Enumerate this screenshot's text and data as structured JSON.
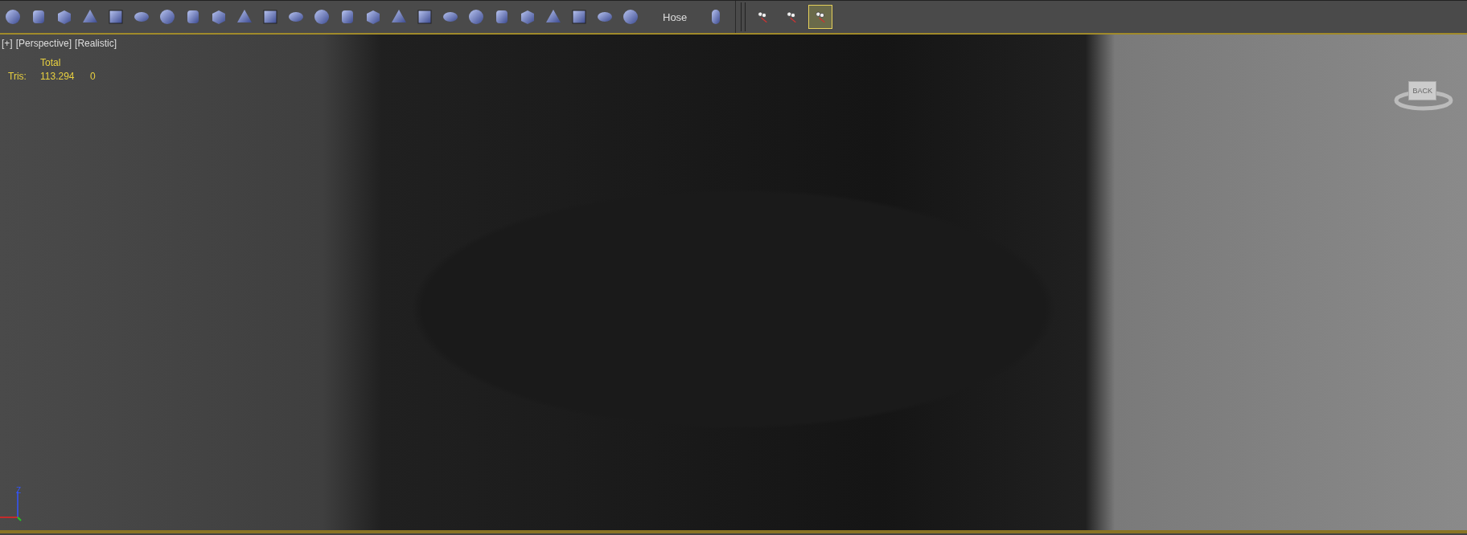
{
  "toolbar": {
    "hose_label": "Hose",
    "tools": [
      {
        "selected": false
      },
      {
        "selected": false
      },
      {
        "selected": true
      }
    ]
  },
  "viewport": {
    "labels": [
      "[+]",
      "[Perspective]",
      "[Realistic]"
    ],
    "stats": {
      "header": "Total",
      "row_label": "Tris:",
      "total": "113.294",
      "selected": "0"
    },
    "viewcube_label": "BACK",
    "axis_label": "Z"
  }
}
